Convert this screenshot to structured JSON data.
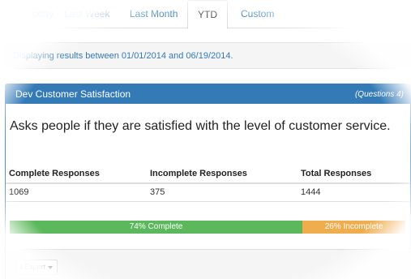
{
  "tabs": [
    {
      "label": "oday"
    },
    {
      "label": "Last Week"
    },
    {
      "label": "Last Month"
    },
    {
      "label": "YTD",
      "active": true
    },
    {
      "label": "Custom"
    }
  ],
  "range_message": "Displaying results between 01/01/2014 and 06/19/2014.",
  "survey": {
    "title": "Dev Customer Satisfaction",
    "question_count": "(Questions 4)",
    "description": "Asks people if they are satisfied with the level of customer service."
  },
  "stats": {
    "headers": [
      "Complete Responses",
      "Incomplete Responses",
      "Total Responses"
    ],
    "values": [
      "1069",
      "375",
      "1444"
    ]
  },
  "progress": {
    "complete_fraction": 0.74,
    "incomplete_fraction": 0.26,
    "complete_label": "74% Complete",
    "incomplete_label": "26% Incomplete"
  },
  "footer": {
    "export_label": "Export",
    "export_icon": "download-icon"
  },
  "colors": {
    "accent": "#337ab7",
    "complete": "#5cb85c",
    "incomplete": "#f0ad4e"
  }
}
